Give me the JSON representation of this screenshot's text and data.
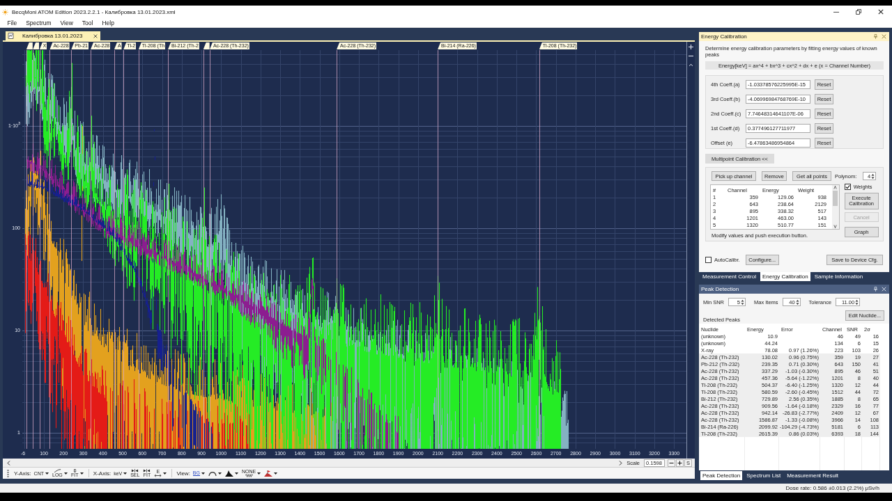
{
  "window": {
    "title": "BecqMoni ATOM Edition 2023.2.2.1 - Калибровка 13.01.2023.xml"
  },
  "menu": [
    "File",
    "Spectrum",
    "View",
    "Tool",
    "Help"
  ],
  "document_tabs": [
    {
      "label": "Калибровка 13.01.2023",
      "selected": true
    }
  ],
  "spectrum": {
    "peak_markers": [
      {
        "kind": "blank"
      },
      {
        "kind": "blank"
      },
      {
        "kind": "tag",
        "label": "X"
      },
      {
        "kind": "tag",
        "label": "Ac-228"
      },
      {
        "kind": "tag",
        "label": "Pb-21"
      },
      {
        "kind": "tag",
        "label": "Ac-228"
      },
      {
        "kind": "tag",
        "label": "A"
      },
      {
        "kind": "tag",
        "label": "Tl-2"
      },
      {
        "kind": "tag",
        "label": "Tl-208 (Th"
      },
      {
        "kind": "tag",
        "label": "Bi-212 (Th-2"
      },
      {
        "kind": "blank"
      },
      {
        "kind": "tag",
        "label": "Ac-228 (Th-232)"
      },
      {
        "kind": "tag",
        "label": "Ac-228 (Th-232)"
      },
      {
        "kind": "tag",
        "label": "Bi-214 (Ra-226)"
      },
      {
        "kind": "tag",
        "label": "Tl-208 (Th-232)"
      }
    ],
    "y_axis_labels": [
      "1·10$^{3}$",
      "100",
      "10",
      "1"
    ],
    "x_axis_labels": [
      "-6",
      "100",
      "200",
      "300",
      "400",
      "500",
      "600",
      "700",
      "800",
      "900",
      "1000",
      "1100",
      "1200",
      "1300",
      "1400",
      "1500",
      "1600",
      "1700",
      "1800",
      "1900",
      "2000",
      "2100",
      "2200",
      "2300",
      "2400",
      "2500",
      "2600",
      "2700",
      "2800",
      "2900",
      "3000",
      "3100",
      "3200",
      "3300"
    ]
  },
  "scale_bar": {
    "label": "Scale",
    "value": "0.1598",
    "button": "S"
  },
  "toolbar": [
    {
      "label": "Y-Axis:",
      "tools": [
        {
          "kind": "text",
          "text": "CNT",
          "dropdown": true
        },
        {
          "kind": "log",
          "text": "LOG",
          "dropdown": true
        },
        {
          "kind": "fit",
          "text": "FIT",
          "dropdown": true
        }
      ]
    },
    {
      "label": "X-Axis:",
      "tools": [
        {
          "kind": "text",
          "text": "keV",
          "dropdown": true
        },
        {
          "kind": "sel",
          "text": "SEL",
          "dropdown": false
        },
        {
          "kind": "sel",
          "text": "FIT",
          "dropdown": false
        },
        {
          "kind": "range",
          "text": "E",
          "dropdown": true
        }
      ]
    },
    {
      "label": "View:",
      "tools": [
        {
          "kind": "underline",
          "text": "BG",
          "dropdown": true
        },
        {
          "kind": "arc",
          "dropdown": true
        },
        {
          "kind": "area",
          "dropdown": true
        },
        {
          "kind": "wave",
          "text": "NONE",
          "dropdown": true
        },
        {
          "kind": "flag",
          "dropdown": true
        }
      ]
    }
  ],
  "energy_calibration": {
    "title": "Energy Calibration",
    "description": "Determine energy calibration parameters by fitting energy values of known peaks",
    "formula": "Energy[keV] = ax^4 + bx^3 + cx^2 + dx + e (x = Channel Number)",
    "coefficients": [
      {
        "label": "4th Coeff.(a)",
        "value": "-1.03378576225995E-15",
        "button": "Reset"
      },
      {
        "label": "3rd Coeff.(b)",
        "value": "-4.06996984768769E-10",
        "button": "Reset"
      },
      {
        "label": "2nd Coeff.(c)",
        "value": "7.74648314641107E-06",
        "button": "Reset"
      },
      {
        "label": "1st Coeff.(d)",
        "value": "0.377496127711977",
        "button": "Reset"
      },
      {
        "label": "Offset (e)",
        "value": "-6.47863486954864",
        "button": "Reset"
      }
    ],
    "multipoint_button": "Multipoint Calibration <<",
    "actions": [
      "Pick up channel",
      "Remove",
      "Get all points"
    ],
    "polynom": {
      "label": "Polynom:",
      "value": "4"
    },
    "weights": {
      "label": "Weights",
      "checked": true
    },
    "points_table": {
      "columns": [
        "#",
        "Channel",
        "Energy",
        "Weight"
      ],
      "rows": [
        [
          "1",
          "359",
          "129.06",
          "938"
        ],
        [
          "2",
          "643",
          "238.64",
          "2129"
        ],
        [
          "3",
          "895",
          "338.32",
          "517"
        ],
        [
          "4",
          "1201",
          "463.00",
          "143"
        ],
        [
          "5",
          "1320",
          "510.77",
          "151"
        ]
      ]
    },
    "side_buttons": [
      {
        "label": "Execute Calibration",
        "disabled": false
      },
      {
        "label": "Cancel",
        "disabled": true
      },
      {
        "label": "Graph",
        "disabled": false
      }
    ],
    "hint": "Modify values and push execution button.",
    "auto_calibration": {
      "label": "AutoCalibr.",
      "checked": false
    },
    "configure_button": "Configure...",
    "save_button": "Save to Device Cfg."
  },
  "panel_tabs": [
    {
      "label": "Measurement Control",
      "selected": false
    },
    {
      "label": "Energy Calibration",
      "selected": true
    },
    {
      "label": "Sample Information",
      "selected": false
    }
  ],
  "peak_detection": {
    "title": "Peak Detection",
    "min_snr": {
      "label": "Min SNR",
      "value": "5"
    },
    "max_items": {
      "label": "Max Items",
      "value": "40"
    },
    "tolerance": {
      "label": "Tolerance",
      "value": "11.00"
    },
    "edit_button": "Edit Nuclide...",
    "list_label": "Detected Peaks",
    "columns": [
      "Nuclide",
      "Energy",
      "Error",
      "Channel",
      "SNR",
      "2σ"
    ],
    "rows": [
      {
        "nuclide": "(unknown)",
        "energy": "10.9",
        "channel": "46",
        "snr": "49",
        "two_sigma": "16",
        "in_calibration": false
      },
      {
        "nuclide": "(unknown)",
        "energy": "44.24",
        "channel": "134",
        "snr": "6",
        "two_sigma": "15",
        "in_calibration": false
      },
      {
        "nuclide": "X-ray",
        "energy": "78.08",
        "error": "0.97 (1.26%)",
        "channel": "223",
        "snr": "103",
        "two_sigma": "26",
        "in_calibration": false
      },
      {
        "nuclide": "Ac-228 (Th-232)",
        "energy": "130.02",
        "error": "0.96 (0.75%)",
        "channel": "359",
        "snr": "19",
        "two_sigma": "27",
        "in_calibration": true
      },
      {
        "nuclide": "Pb-212 (Th-232)",
        "energy": "239.35",
        "error": "0.71 (0.30%)",
        "channel": "643",
        "snr": "150",
        "two_sigma": "41",
        "in_calibration": true
      },
      {
        "nuclide": "Ac-228 (Th-232)",
        "energy": "337.29",
        "error": "-1.03 (-0.30%)",
        "channel": "895",
        "snr": "46",
        "two_sigma": "51",
        "in_calibration": true
      },
      {
        "nuclide": "Ac-228 (Th-232)",
        "energy": "457.36",
        "error": "-5.64 (-1.22%)",
        "channel": "1201",
        "snr": "8",
        "two_sigma": "40",
        "in_calibration": true
      },
      {
        "nuclide": "Tl-208 (Th-232)",
        "energy": "504.37",
        "error": "-6.40 (-1.25%)",
        "channel": "1320",
        "snr": "12",
        "two_sigma": "44",
        "in_calibration": true
      },
      {
        "nuclide": "Tl-208 (Th-232)",
        "energy": "580.59",
        "error": "-2.60 (-0.45%)",
        "channel": "1512",
        "snr": "44",
        "two_sigma": "72",
        "in_calibration": true
      },
      {
        "nuclide": "Bi-212 (Th-232)",
        "energy": "729.89",
        "error": "2.56 (0.35%)",
        "channel": "1885",
        "snr": "8",
        "two_sigma": "65",
        "in_calibration": true
      },
      {
        "nuclide": "Ac-228 (Th-232)",
        "energy": "909.56",
        "error": "-1.64 (-0.18%)",
        "channel": "2329",
        "snr": "16",
        "two_sigma": "77",
        "in_calibration": true
      },
      {
        "nuclide": "Ac-228 (Th-232)",
        "energy": "942.14",
        "error": "-26.83 (-2.77%)",
        "channel": "2409",
        "snr": "12",
        "two_sigma": "67",
        "in_calibration": true
      },
      {
        "nuclide": "Ac-228 (Th-232)",
        "energy": "1586.87",
        "error": "-1.33 (-0.08%)",
        "channel": "3966",
        "snr": "14",
        "two_sigma": "108",
        "in_calibration": true
      },
      {
        "nuclide": "Bi-214 (Ra-226)",
        "energy": "2099.92",
        "error": "-104.29 (-4.73%)",
        "channel": "5181",
        "snr": "6",
        "two_sigma": "113",
        "in_calibration": true
      },
      {
        "nuclide": "Tl-208 (Th-232)",
        "energy": "2615.39",
        "error": "0.86 (0.03%)",
        "channel": "6393",
        "snr": "18",
        "two_sigma": "144",
        "in_calibration": true
      }
    ]
  },
  "bottom_tabs": [
    {
      "label": "Peak Detection",
      "selected": true
    },
    {
      "label": "Spectrum List",
      "selected": false
    },
    {
      "label": "Measurement Result",
      "selected": false
    }
  ],
  "status_bar": {
    "dose_rate": "Dose rate: 0.586 ±0.013 (2.2%) μSv/h"
  }
}
